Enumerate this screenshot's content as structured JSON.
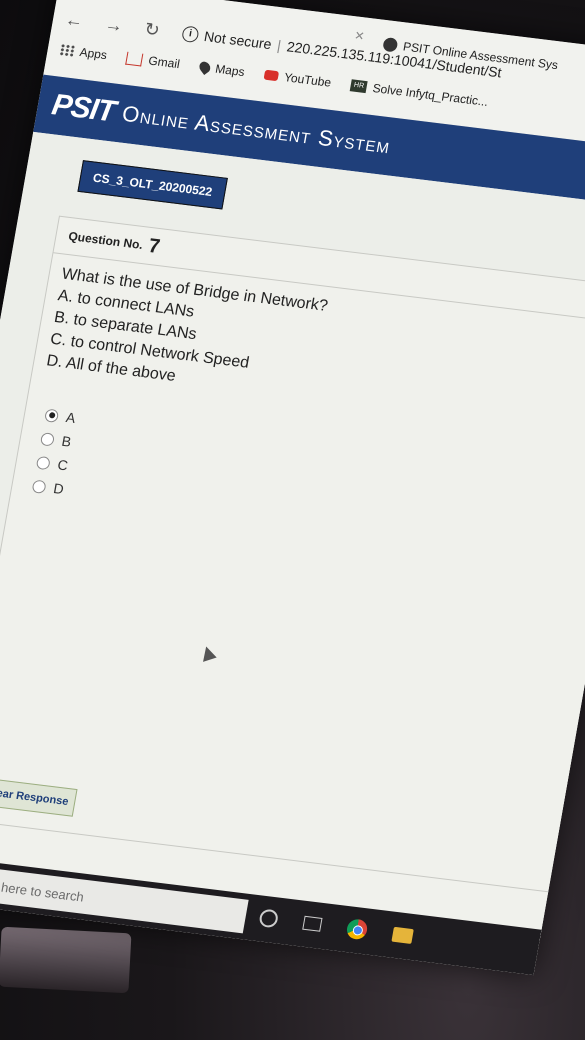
{
  "browser": {
    "tab_title": "PSIT Online Assessment Sys",
    "security_label": "Not secure",
    "address": "220.225.135.119:10041/Student/St",
    "bookmarks": [
      {
        "label": "Apps",
        "icon": "apps-grid-icon"
      },
      {
        "label": "Gmail",
        "icon": "gmail-icon"
      },
      {
        "label": "Maps",
        "icon": "maps-pin-icon"
      },
      {
        "label": "YouTube",
        "icon": "youtube-icon"
      },
      {
        "label": "Solve Infytq_Practic...",
        "icon": "hackerrank-icon"
      }
    ]
  },
  "header": {
    "brand": "PSIT",
    "subtitle": "Online Assessment System"
  },
  "exam": {
    "code": "CS_3_OLT_20200522"
  },
  "question": {
    "label": "Question No.",
    "number": "7",
    "text": "What is the use of Bridge in Network?",
    "choices": [
      "A. to connect LANs",
      "B. to separate LANs",
      "C. to control Network Speed",
      "D. All of the above"
    ],
    "options": [
      "A",
      "B",
      "C",
      "D"
    ],
    "selected": "A"
  },
  "actions": {
    "clear_label": "Clear Response"
  },
  "taskbar": {
    "search_placeholder": "Type here to search"
  },
  "colors": {
    "header_bg": "#1f3f7a",
    "badge_bg": "#1f3f7a",
    "clear_button_bg": "#dfe5d5"
  }
}
